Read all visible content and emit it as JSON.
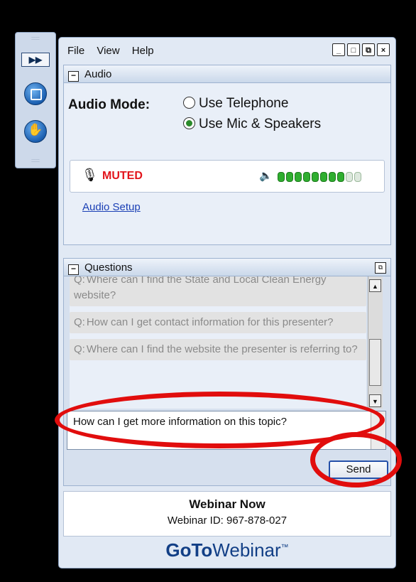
{
  "menu": {
    "file": "File",
    "view": "View",
    "help": "Help"
  },
  "window_buttons": {
    "minimize": "_",
    "maximize": "□",
    "restore": "⧉",
    "close": "×"
  },
  "audio": {
    "header": "Audio",
    "mode_label": "Audio Mode:",
    "options": [
      {
        "label": "Use Telephone",
        "selected": false
      },
      {
        "label": "Use Mic & Speakers",
        "selected": true
      }
    ],
    "mic_status": "MUTED",
    "speaker_level": 0.8,
    "setup_link": "Audio Setup"
  },
  "questions": {
    "header": "Questions",
    "prefix": "Q:",
    "items": [
      "Where can I find the State and Local Clean Energy website?",
      "How can I get contact information for this presenter?",
      "Where can I find the website the presenter is referring to?"
    ],
    "input_value": "How can I get more information on this topic?",
    "send_label": "Send"
  },
  "footer": {
    "title": "Webinar Now",
    "webinar_id": "Webinar ID: 967-878-027",
    "brand_goto": "GoTo",
    "brand_webinar": "Webinar",
    "brand_tm": "™"
  },
  "colors": {
    "muted": "#e2141b",
    "level_on": "#2fae2f",
    "annotation": "#e10d0d",
    "brand": "#123f86"
  }
}
